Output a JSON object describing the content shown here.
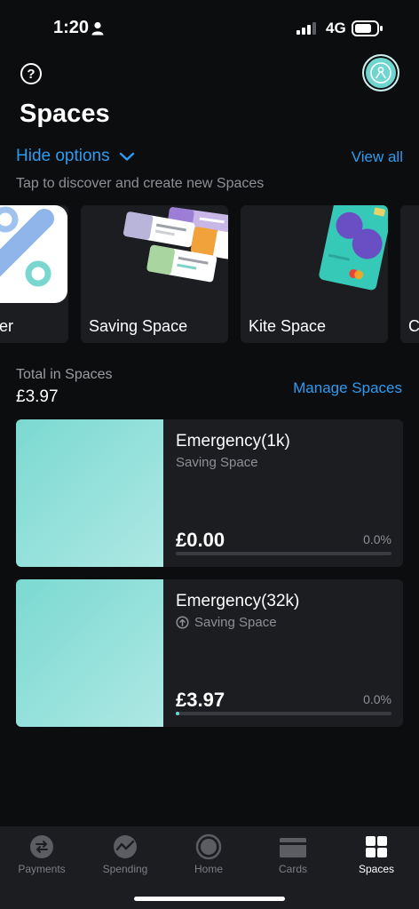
{
  "status": {
    "time": "1:20",
    "network": "4G"
  },
  "header": {
    "help_label": "?",
    "title": "Spaces"
  },
  "options": {
    "hide_label": "Hide options",
    "view_all_label": "View all",
    "subtitle": "Tap to discover and create new Spaces"
  },
  "carousel": [
    {
      "label": "ver"
    },
    {
      "label": "Saving Space"
    },
    {
      "label": "Kite Space"
    },
    {
      "label": "C"
    }
  ],
  "totals": {
    "label": "Total in Spaces",
    "value": "£3.97",
    "manage_label": "Manage Spaces"
  },
  "spaces": [
    {
      "name": "Emergency(1k)",
      "type": "Saving Space",
      "amount": "£0.00",
      "percent": "0.0%",
      "progress": 0.0
    },
    {
      "name": "Emergency(32k)",
      "type": "Saving Space",
      "amount": "£3.97",
      "percent": "0.0%",
      "progress": 0.0
    }
  ],
  "nav": [
    {
      "label": "Payments",
      "icon": "payments-icon"
    },
    {
      "label": "Spending",
      "icon": "spending-icon"
    },
    {
      "label": "Home",
      "icon": "home-icon"
    },
    {
      "label": "Cards",
      "icon": "cards-icon"
    },
    {
      "label": "Spaces",
      "icon": "spaces-icon",
      "active": true
    }
  ],
  "colors": {
    "accent": "#2e9bf0",
    "teal": "#6fd6cf",
    "background": "#0c0d0f",
    "card": "#1c1d21"
  }
}
